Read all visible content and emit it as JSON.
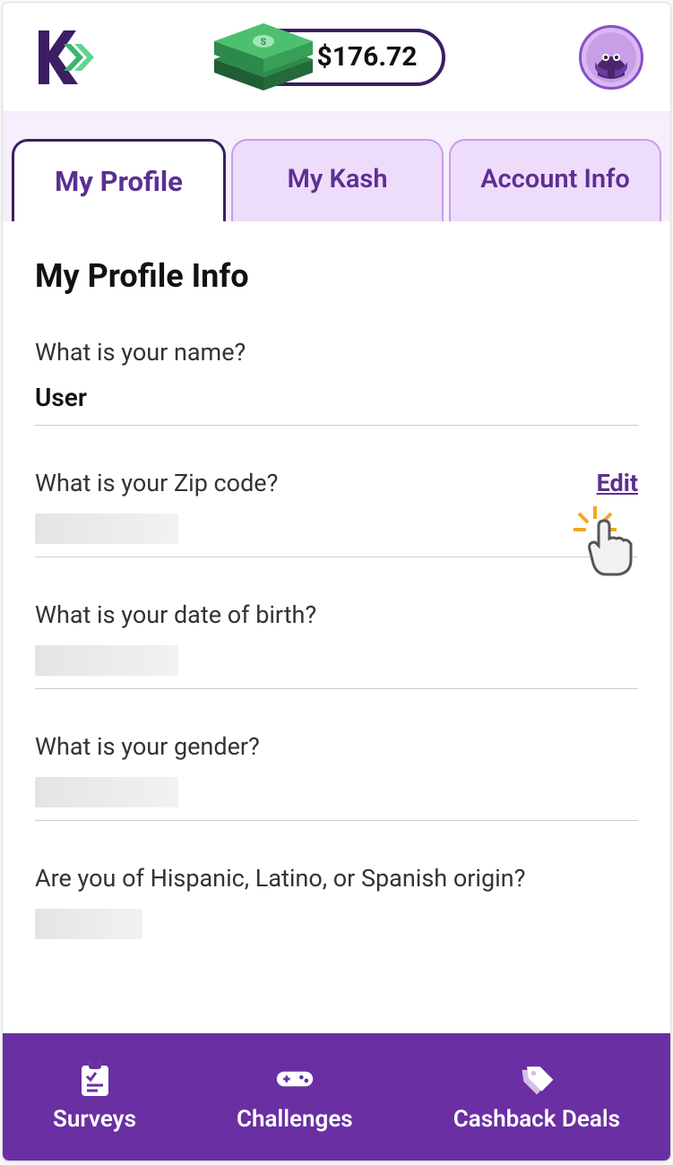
{
  "header": {
    "balance": "$176.72"
  },
  "tabs": {
    "profile": "My Profile",
    "kash": "My Kash",
    "account": "Account Info"
  },
  "content": {
    "title": "My Profile Info",
    "fields": {
      "name": {
        "label": "What is your name?",
        "value": "User"
      },
      "zip": {
        "label": "What is your Zip code?",
        "edit": "Edit"
      },
      "dob": {
        "label": "What is your date of birth?"
      },
      "gender": {
        "label": "What is your gender?"
      },
      "hispanic": {
        "label": "Are you of Hispanic, Latino, or Spanish origin?"
      }
    }
  },
  "nav": {
    "surveys": "Surveys",
    "challenges": "Challenges",
    "cashback": "Cashback Deals"
  }
}
